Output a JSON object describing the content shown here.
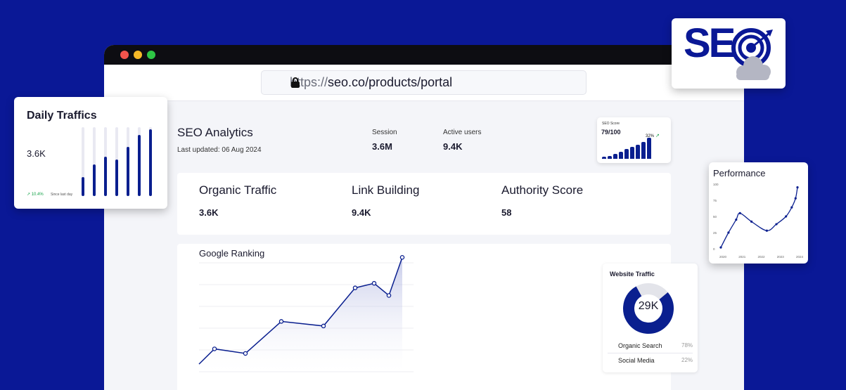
{
  "browser": {
    "url_protocol": "https://",
    "url_host": "seo.co/products/portal"
  },
  "header": {
    "title": "SEO Analytics",
    "last_updated": "Last updated: 06 Aug 2024",
    "session_label": "Session",
    "session_value": "3.6M",
    "active_users_label": "Active users",
    "active_users_value": "9.4K"
  },
  "seo_score": {
    "title": "SEO Score",
    "value": "79/100",
    "change": "32%",
    "bars": [
      0.1,
      0.14,
      0.22,
      0.32,
      0.46,
      0.58,
      0.66,
      0.8,
      1.0
    ]
  },
  "metrics": [
    {
      "label": "Organic Traffic",
      "value": "3.6K"
    },
    {
      "label": "Link Building",
      "value": "9.4K"
    },
    {
      "label": "Authority Score",
      "value": "58"
    }
  ],
  "ranking": {
    "title": "Google Ranking"
  },
  "website_traffic": {
    "title": "Website Traffic",
    "total": "29K",
    "rows": [
      {
        "label": "Organic Search",
        "pct": "78%"
      },
      {
        "label": "Social Media",
        "pct": "22%"
      }
    ],
    "colors": {
      "organic": "#0a1f8f",
      "social": "#e3e4ea"
    }
  },
  "daily": {
    "title": "Daily Traffics",
    "value": "3.6K",
    "change": "10.4%",
    "change_note": "Since last day",
    "bars": [
      0.28,
      0.46,
      0.57,
      0.53,
      0.71,
      0.89,
      0.97
    ]
  },
  "performance": {
    "title": "Performance"
  },
  "chart_data": [
    {
      "type": "area",
      "title": "Google Ranking",
      "x": [
        0,
        1,
        2,
        3,
        4,
        5,
        6,
        7,
        8,
        9
      ],
      "values": [
        5,
        15,
        12,
        33,
        30,
        55,
        58,
        50,
        75,
        73
      ],
      "ylim": [
        0,
        100
      ]
    },
    {
      "type": "line",
      "title": "Performance",
      "x": [
        2020,
        2020.4,
        2020.8,
        2021,
        2021.6,
        2022.4,
        2022.9,
        2023.4,
        2023.7,
        2023.9,
        2024
      ],
      "values": [
        2,
        25,
        45,
        55,
        42,
        28,
        38,
        50,
        64,
        78,
        95
      ],
      "xticks": [
        "2020",
        "2021",
        "2022",
        "2023",
        "2024"
      ],
      "yticks": [
        "0",
        "25",
        "50",
        "75",
        "100"
      ],
      "ylim": [
        0,
        100
      ]
    },
    {
      "type": "pie",
      "title": "Website Traffic",
      "categories": [
        "Organic Search",
        "Social Media"
      ],
      "values": [
        78,
        22
      ]
    }
  ],
  "icons": {
    "lock": "lock-icon",
    "trend": "trend-up-icon",
    "target": "target-icon",
    "cloud": "cloud-icon"
  },
  "seo_logo": {
    "text": "SE"
  }
}
